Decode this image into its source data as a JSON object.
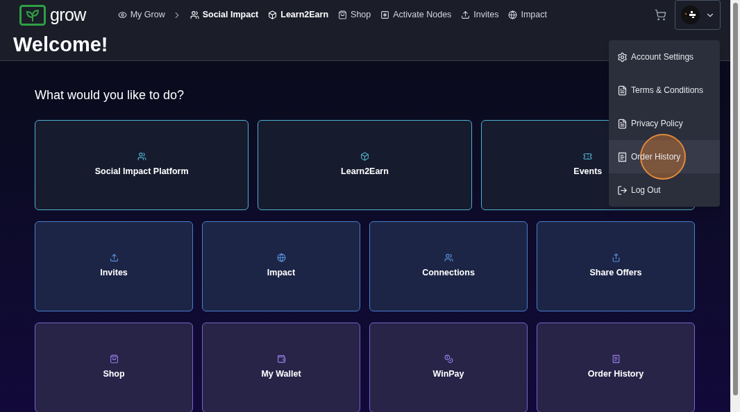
{
  "logo": {
    "text": "grow"
  },
  "nav": [
    {
      "label": "My Grow",
      "bold": false
    },
    {
      "label": "Social Impact",
      "bold": true
    },
    {
      "label": "Learn2Earn",
      "bold": true
    },
    {
      "label": "Shop",
      "bold": false
    },
    {
      "label": "Activate Nodes",
      "bold": false
    },
    {
      "label": "Invites",
      "bold": false
    },
    {
      "label": "Impact",
      "bold": false
    }
  ],
  "page_title": "Welcome!",
  "prompt": "What would you like to do?",
  "card_rows": [
    {
      "cards": [
        {
          "label": "Social Impact Platform"
        },
        {
          "label": "Learn2Earn"
        },
        {
          "label": "Events"
        }
      ]
    },
    {
      "cards": [
        {
          "label": "Invites"
        },
        {
          "label": "Impact"
        },
        {
          "label": "Connections"
        },
        {
          "label": "Share Offers"
        }
      ]
    },
    {
      "cards": [
        {
          "label": "Shop"
        },
        {
          "label": "My Wallet"
        },
        {
          "label": "WinPay"
        },
        {
          "label": "Order History"
        }
      ]
    }
  ],
  "account_menu": [
    {
      "label": "Account Settings",
      "selected": false
    },
    {
      "label": "Terms & Conditions",
      "selected": false
    },
    {
      "label": "Privacy Policy",
      "selected": false
    },
    {
      "label": "Order History",
      "selected": true
    },
    {
      "label": "Log Out",
      "selected": false
    }
  ]
}
